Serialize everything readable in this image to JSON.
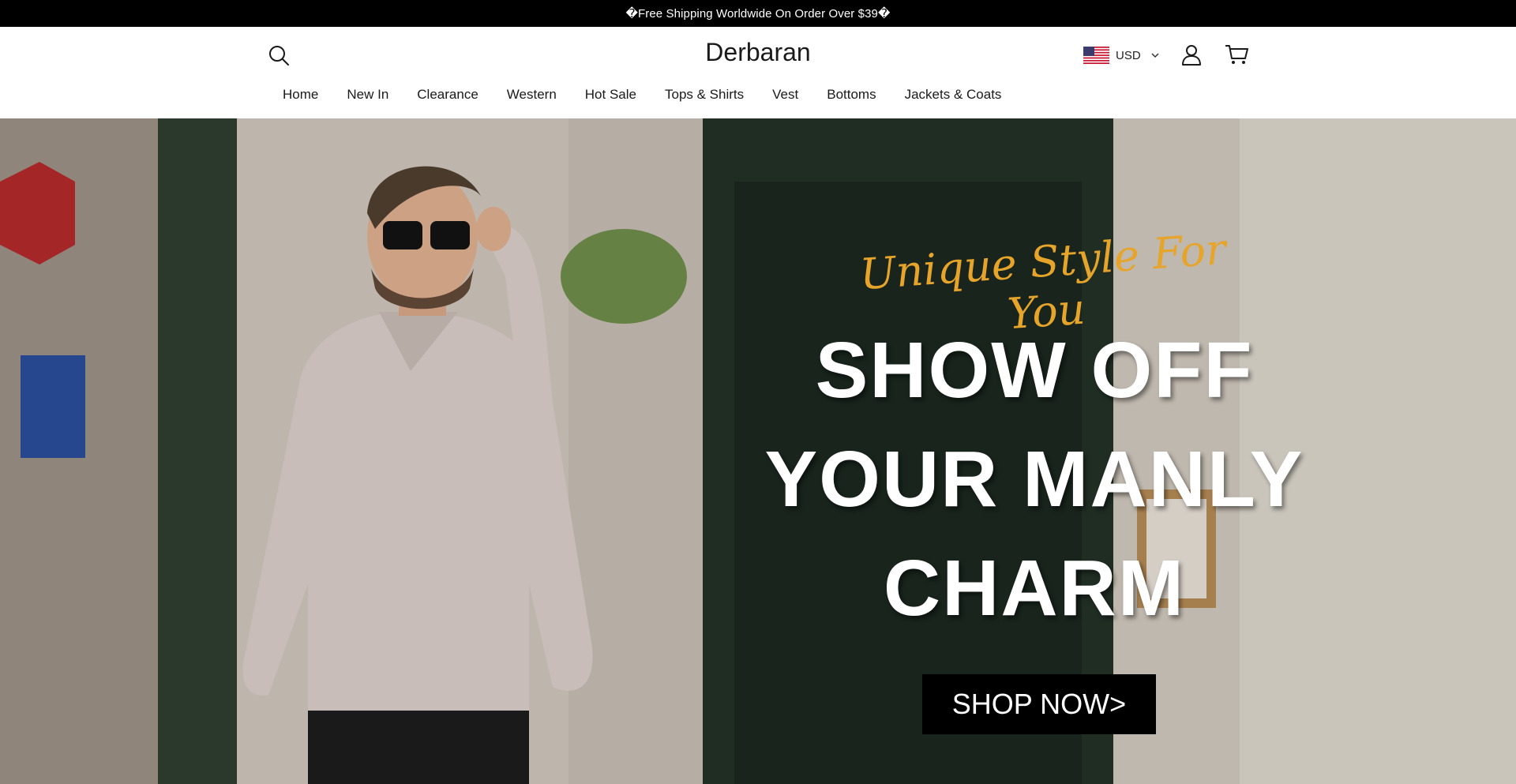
{
  "announcement": {
    "text": "�Free Shipping Worldwide On Order Over $39�"
  },
  "header": {
    "logo": "Derbaran",
    "currency": "USD",
    "icons": {
      "search": "search-icon",
      "account": "user-icon",
      "cart": "cart-icon",
      "flag": "us-flag-icon",
      "chevron": "chevron-down-icon"
    }
  },
  "nav": {
    "items": [
      {
        "label": "Home"
      },
      {
        "label": "New In"
      },
      {
        "label": "Clearance"
      },
      {
        "label": "Western"
      },
      {
        "label": "Hot Sale"
      },
      {
        "label": "Tops & Shirts"
      },
      {
        "label": "Vest"
      },
      {
        "label": "Bottoms"
      },
      {
        "label": "Jackets & Coats"
      }
    ]
  },
  "hero": {
    "script_text": "Unique Style For You",
    "headline_line1": "SHOW OFF",
    "headline_line2": "YOUR MANLY",
    "headline_line3": "CHARM",
    "cta": "SHOP NOW>",
    "colors": {
      "script": "#e6a52a",
      "cta_bg": "#000000",
      "headline": "#ffffff"
    }
  }
}
